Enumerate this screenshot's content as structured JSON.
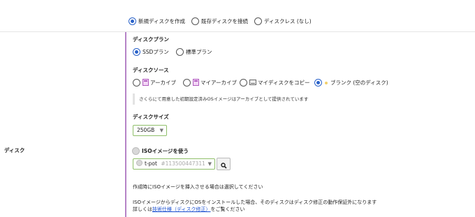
{
  "disk_mode": {
    "options": [
      {
        "label": "新規ディスクを作成",
        "selected": true
      },
      {
        "label": "既存ディスクを接続",
        "selected": false
      },
      {
        "label": "ディスクレス (なし)",
        "selected": false
      }
    ]
  },
  "section_label": "ディスク",
  "plan": {
    "heading": "ディスクプラン",
    "options": [
      {
        "label": "SSDプラン",
        "selected": true
      },
      {
        "label": "標準プラン",
        "selected": false
      }
    ]
  },
  "source": {
    "heading": "ディスクソース",
    "options": [
      {
        "label": "アーカイブ",
        "icon": "archive-icon",
        "selected": false
      },
      {
        "label": "マイアーカイブ",
        "icon": "my-archive-icon",
        "selected": false
      },
      {
        "label": "マイディスクをコピー",
        "icon": "disk-icon",
        "selected": false
      },
      {
        "label": "ブランク (空のディスク)",
        "icon": "blank-dot-icon",
        "selected": true
      }
    ],
    "info": "さくらにて用意した初期設定済みOSイメージはアーカイブとして提供されています"
  },
  "size": {
    "heading": "ディスクサイズ",
    "value": "250GB"
  },
  "iso": {
    "checkbox_label": "ISOイメージを使う",
    "select_name": "t-pot",
    "select_id": "#113500447311",
    "note1": "作成時にISOイメージを挿入させる場合は選択してください",
    "note2": "ISOイメージからディスクにOSをインストールした場合、そのディスクはディスク修正の動作保証外になります",
    "note3_prefix": "詳しくは",
    "note3_link": "技術仕様（ディスク修正）",
    "note3_suffix": "をご覧ください"
  },
  "colors": {
    "accent": "#2a62c9",
    "divider": "#b583c7",
    "select_border": "#8fbf6a",
    "link": "#1a4fd0"
  }
}
